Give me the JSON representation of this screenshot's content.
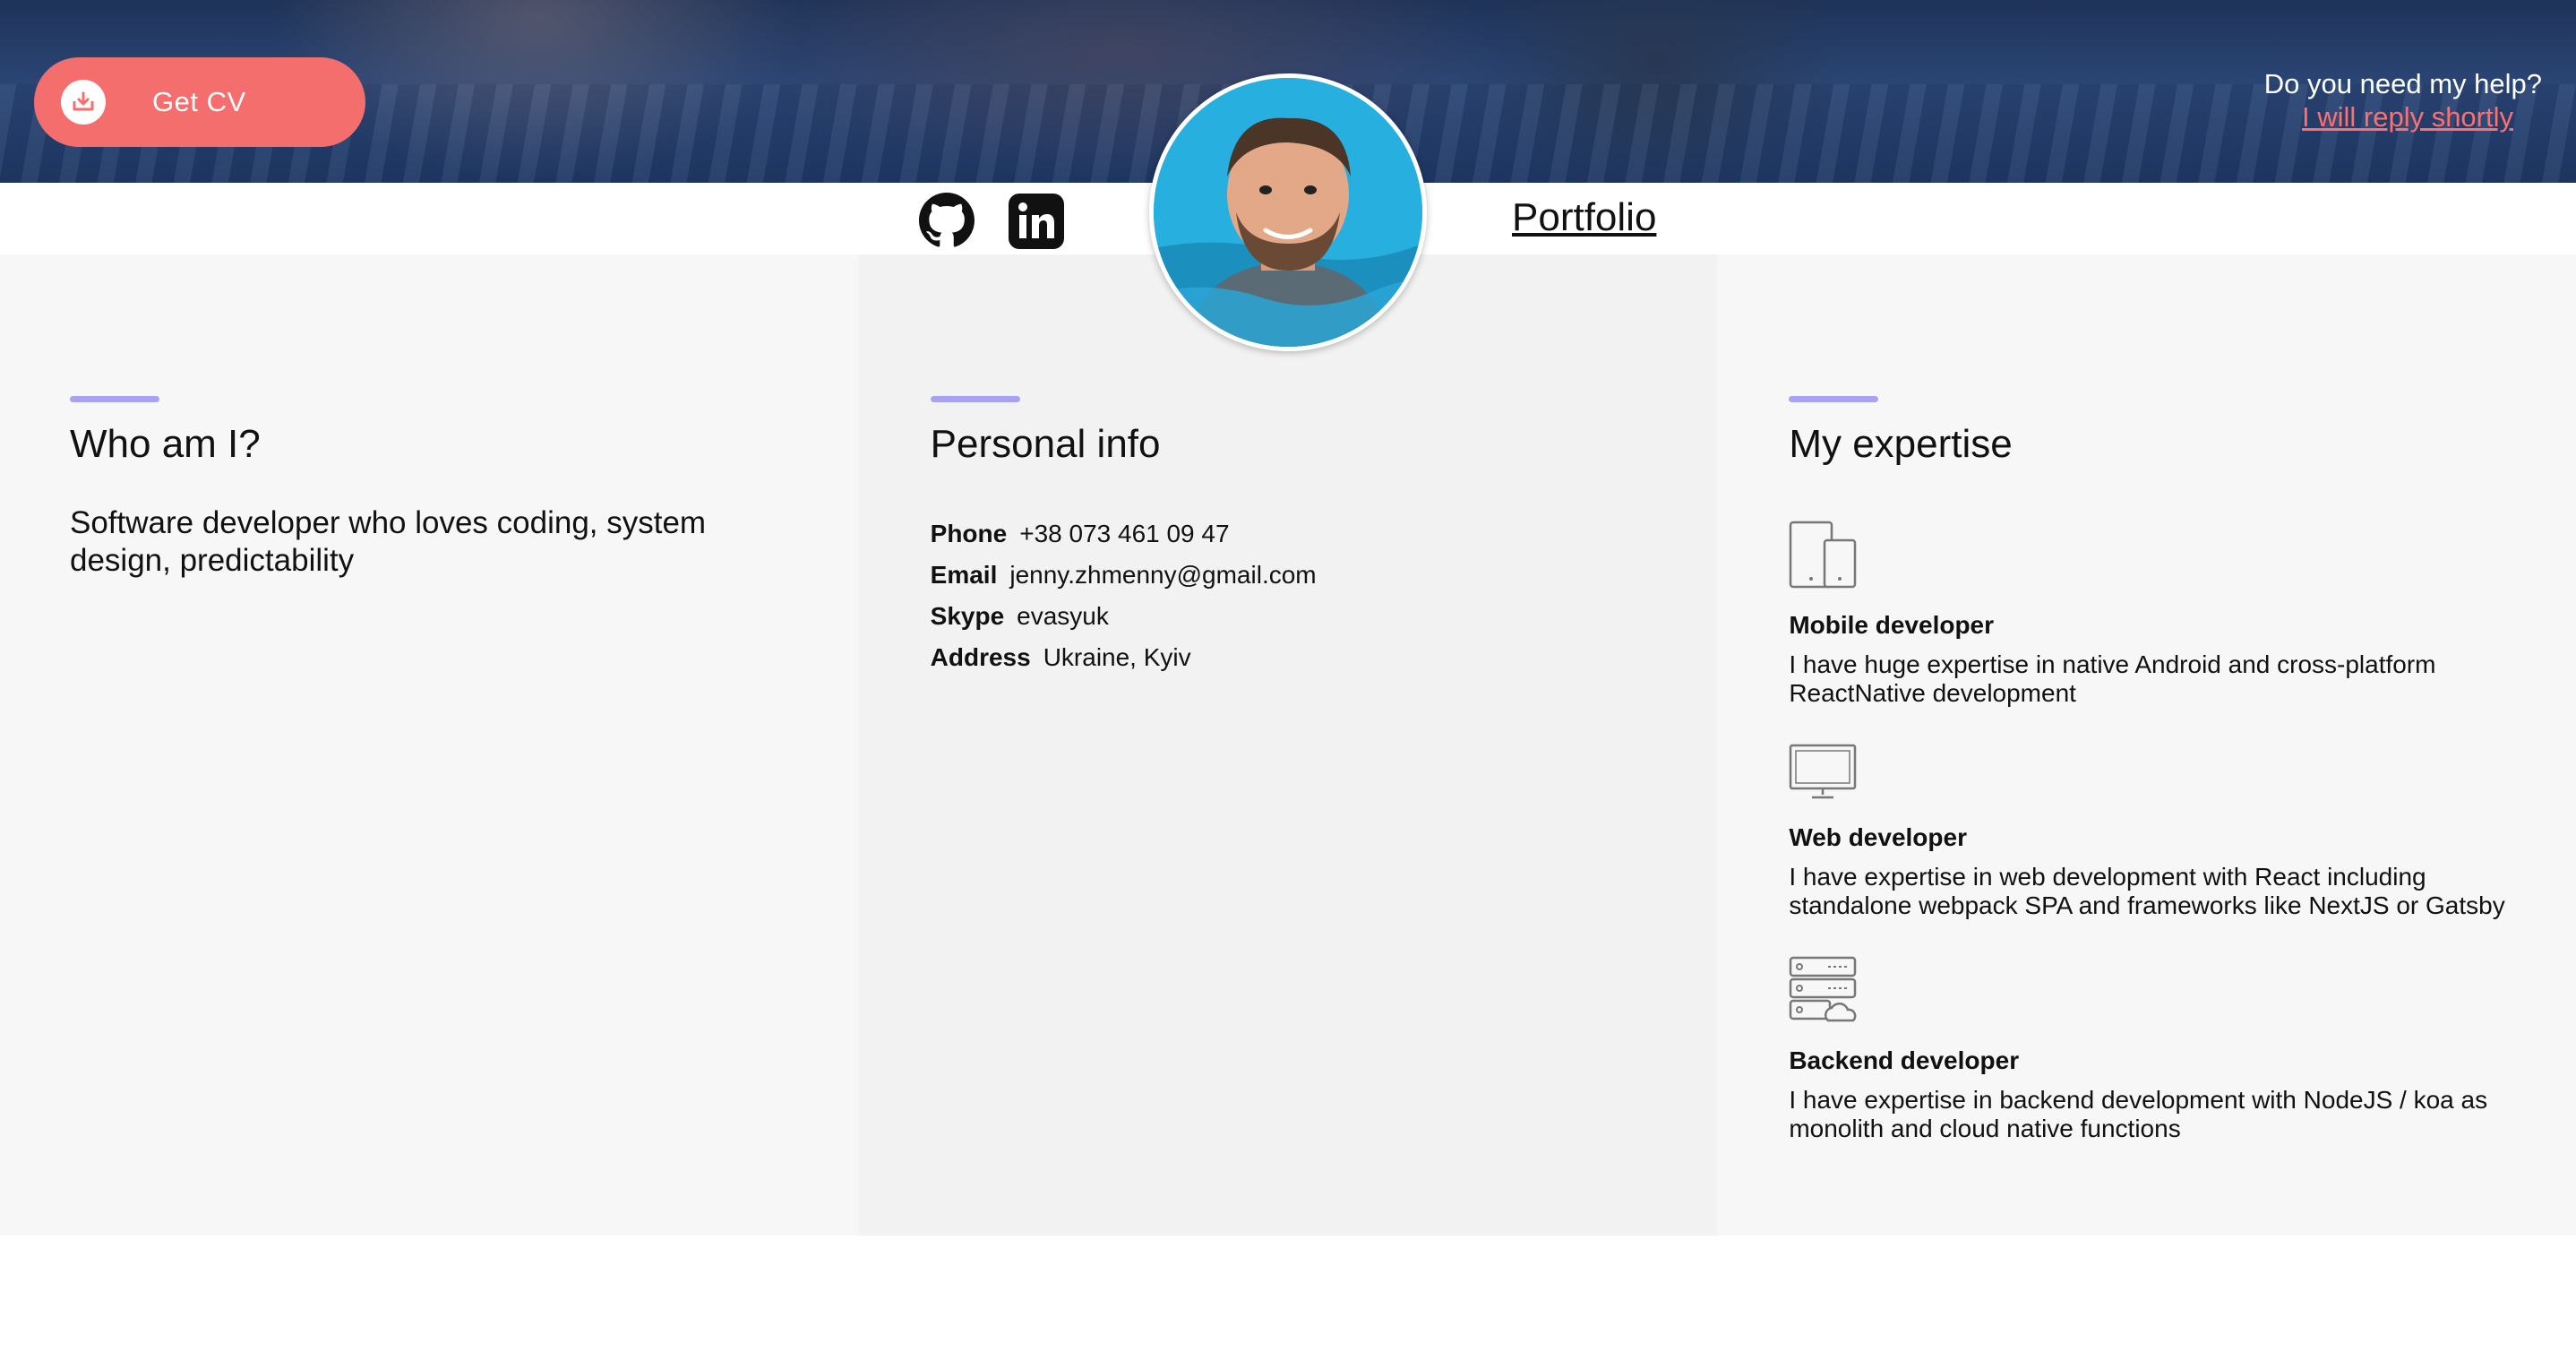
{
  "header": {
    "cv_button_label": "Get CV",
    "help_text": "Do you need my help?",
    "help_link": "I will reply shortly"
  },
  "nav": {
    "portfolio_label": "Portfolio"
  },
  "about": {
    "title": "Who am I?",
    "text": "Software developer who loves coding, system design, predictability"
  },
  "personal_info": {
    "title": "Personal info",
    "rows": [
      {
        "key": "Phone",
        "value": "+38 073 461 09 47"
      },
      {
        "key": "Email",
        "value": "jenny.zhmenny@gmail.com"
      },
      {
        "key": "Skype",
        "value": "evasyuk"
      },
      {
        "key": "Address",
        "value": "Ukraine, Kyiv"
      }
    ]
  },
  "expertise": {
    "title": "My expertise",
    "items": [
      {
        "icon": "devices-icon",
        "title": "Mobile developer",
        "desc": "I have huge expertise in native Android and cross-platform ReactNative development"
      },
      {
        "icon": "monitor-icon",
        "title": "Web developer",
        "desc": "I have expertise in web development with React including standalone webpack SPA and frameworks like NextJS or Gatsby"
      },
      {
        "icon": "server-cloud-icon",
        "title": "Backend developer",
        "desc": "I have expertise in backend development with NodeJS / koa as monolith and cloud native functions"
      }
    ]
  },
  "colors": {
    "accent": "#a7a3f2",
    "cv_button": "#f46e6e",
    "link": "#ff6f6f"
  }
}
